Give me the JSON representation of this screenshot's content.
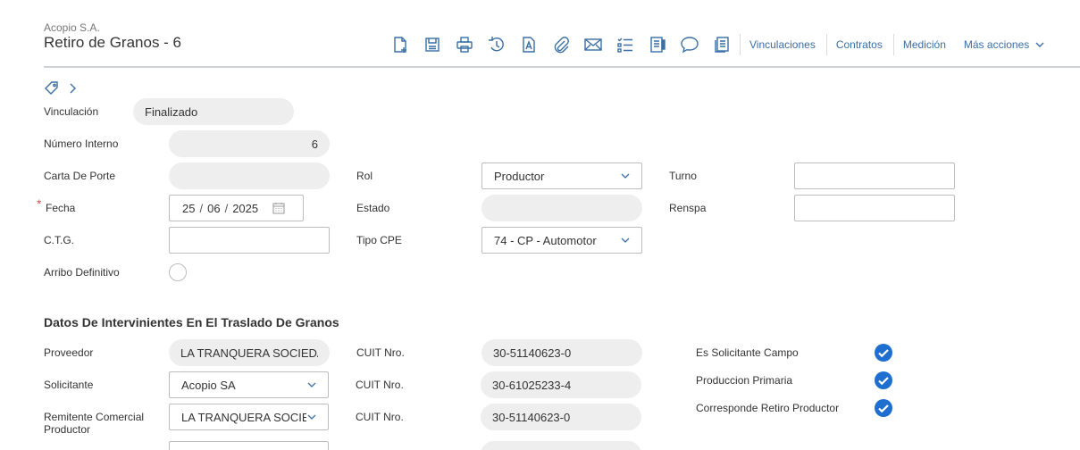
{
  "header": {
    "company": "Acopio S.A.",
    "title": "Retiro de Granos - 6"
  },
  "toolbar": {
    "icons": [
      "new-document-icon",
      "save-icon",
      "print-icon",
      "history-icon",
      "text-document-icon",
      "attachment-icon",
      "email-icon",
      "checklist-icon",
      "document-view-icon",
      "comment-icon",
      "pages-icon"
    ],
    "links": [
      "Vinculaciones",
      "Contratos",
      "Medición",
      "Más acciones"
    ]
  },
  "form": {
    "vinculacion": {
      "label": "Vinculación",
      "value": "Finalizado"
    },
    "numero_interno": {
      "label": "Número Interno",
      "value": "6"
    },
    "carta_de_porte": {
      "label": "Carta De Porte",
      "value": ""
    },
    "fecha": {
      "label": "Fecha",
      "required_mark": "*",
      "day": "25",
      "month": "06",
      "year": "2025",
      "separator": "/"
    },
    "ctg": {
      "label": "C.T.G.",
      "value": ""
    },
    "arribo_definitivo": {
      "label": "Arribo Definitivo",
      "checked": false
    },
    "rol": {
      "label": "Rol",
      "value": "Productor"
    },
    "estado": {
      "label": "Estado",
      "value": ""
    },
    "tipo_cpe": {
      "label": "Tipo CPE",
      "value": "74 - CP - Automotor"
    },
    "turno": {
      "label": "Turno",
      "value": ""
    },
    "renspa": {
      "label": "Renspa",
      "value": ""
    }
  },
  "section": {
    "title": "Datos De Intervinientes En El Traslado De Granos",
    "proveedor": {
      "label": "Proveedor",
      "value": "LA TRANQUERA SOCIEDAD",
      "cuit_label": "CUIT Nro.",
      "cuit": "30-51140623-0"
    },
    "solicitante": {
      "label": "Solicitante",
      "value": "Acopio SA",
      "cuit_label": "CUIT Nro.",
      "cuit": "30-61025233-4"
    },
    "remitente": {
      "label_line1": "Remitente Comercial",
      "label_line2": "Productor",
      "value": "LA TRANQUERA SOCIEDAD",
      "cuit_label": "CUIT Nro.",
      "cuit": "30-51140623-0"
    },
    "checks": [
      {
        "label": "Es Solicitante Campo",
        "checked": true
      },
      {
        "label": "Produccion Primaria",
        "checked": true
      },
      {
        "label": "Corresponde Retiro Productor",
        "checked": true
      }
    ]
  },
  "colors": {
    "accent": "#3a6ea5",
    "check": "#1e6fd0",
    "required": "#d9534f"
  }
}
